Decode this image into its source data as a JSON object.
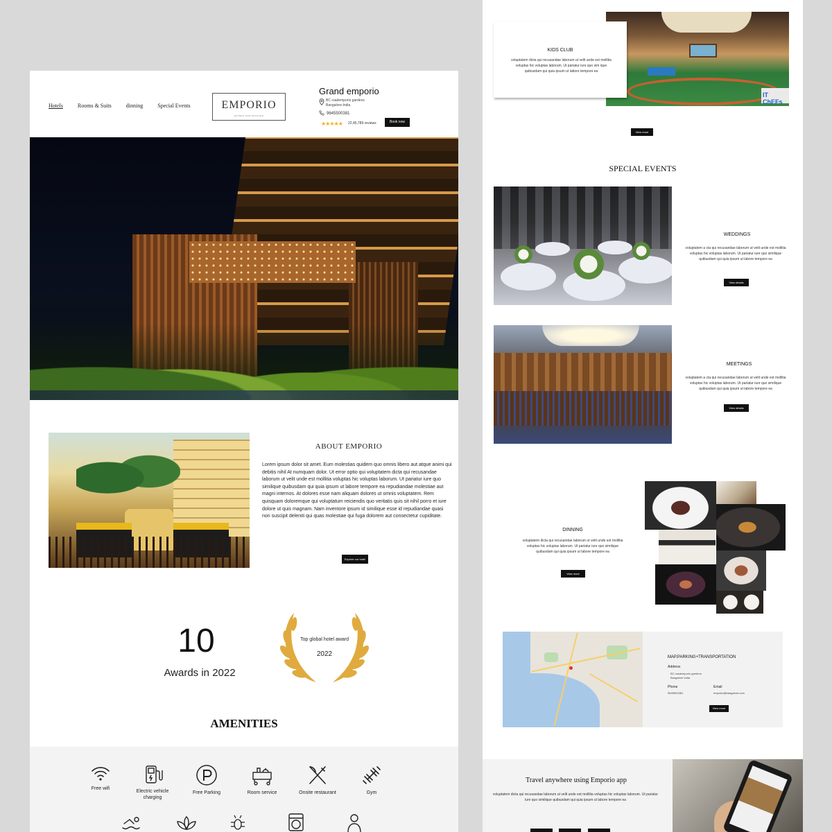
{
  "header": {
    "nav": [
      "Hotels",
      "Rooms & Suits",
      "dinning",
      "Special Events"
    ],
    "logo_text": "EMPORIO",
    "logo_sub": "HOTELS AND PALACES",
    "hotel_name": "Grand emporio",
    "address_line1": "BC roademporio gardens",
    "address_line2": "Bangalore-India",
    "phone": "9645500381",
    "stars": "★★★★★",
    "rating_value": "22,45,789",
    "rating_suffix": "reviews",
    "book_now": "Book now"
  },
  "about": {
    "title": "ABOUT EMPORIO",
    "text": "Lorem ipsum dolor sit amet. Eum molestias quidem quo omnis libero aut atque animi qui debitis nihil At numquam dolor. Ut error optio qui voluptatem dicta qui recusandae laborum ut velit unde est mollitia voluptas hic voluptas laborum. Ut pariatur iure quo similique quibusdam qui quia ipsum ut labore tempore ea repudiandae molestiae aut magni internos. At dolores esse nam aliquam dolores ut omnis voluptatem. Rem quisquam doloremque qui voluptatum reiciendis quo veritatis quis sit nihil porro et iure dolore ut quis magnam. Nam inventore ipsum id similique esse id repudiandae quasi non suscipit deleniti qui quas molestiae qui fuga dolorem aut consectetur cupiditate.",
    "button": "Explore our hotel"
  },
  "awards": {
    "count": "10",
    "label": "Awards in 2022",
    "badge_title": "Top global hotel award",
    "badge_year": "2022"
  },
  "amenities": {
    "title": "AMENITIES",
    "items": [
      {
        "label": "Free wifi",
        "icon": "wifi-icon"
      },
      {
        "label": "Electric vehicle charging",
        "icon": "ev-charging-icon"
      },
      {
        "label": "Free Parking",
        "icon": "parking-icon"
      },
      {
        "label": "Room service",
        "icon": "room-service-icon"
      },
      {
        "label": "Onsite restaurant",
        "icon": "restaurant-icon"
      },
      {
        "label": "Gym",
        "icon": "gym-icon"
      }
    ],
    "row2_icons": [
      "swimming-icon",
      "spa-icon",
      "bug-icon",
      "laundry-icon",
      "staff-icon"
    ]
  },
  "kids_club": {
    "title": "KIDS CLUB",
    "text": "voluptatem dicta qui recusandae laborum ut velit unde est mollitia voluptas hic voluptas laborum. Ut pariatur iure quo sim ique quibusdam qui quia ipsum ut labore tempore ea",
    "sign": "IT ChEFs",
    "button": "View more"
  },
  "special_events": {
    "title": "SPECIAL EVENTS",
    "weddings": {
      "title": "WEDDINGS",
      "text": "voluptatem a cta qui recusandae laborum ut velit unde est mollitia voluptas hic voluptas laborum. Ut pariatur iure quo similique quibusdam qui quia ipsum ut labore tempore ea",
      "button": "View details"
    },
    "meetings": {
      "title": "MEETINGS",
      "text": "voluptatem a cta qui recusandae laborum ut velit unde est mollitia voluptas hic voluptas laborum. Ut pariatur iure quo similique quibusdam qui quia ipsum ut labore tempore ea",
      "button": "View details"
    }
  },
  "dinning": {
    "title": "DINNING",
    "text": "voluptatem dicta qui recusandae laborum ut velit unde est mollitia voluptas hic voluptas laborum. Ut pariatur iure quo similique quibusdam qui quia ipsum ut labore tempore ea",
    "button": "View more"
  },
  "map": {
    "title": "MAP,PARKING+TRANSPORTATION",
    "address_label": "Address",
    "address_line1": "BC roademporio gardens",
    "address_line2": "Bangalore India",
    "phone_label": "Phone",
    "phone": "9645500381",
    "email_label": "Email",
    "email": "emporio@bangalore.com",
    "button": "View more"
  },
  "app": {
    "title": "Travel anywhere using Emporio app",
    "text": "voluptatem dicta qui recusandae laborum ut velit unde est mollitia voluptas hic voluptas laborum. Ut pariatur iure quo similique quibusdam qui quia ipsum ut labore tempore ea",
    "stores": [
      "app-store-badge",
      "google-play-badge",
      "app-gallery-badge"
    ]
  },
  "colors": {
    "accent_dark": "#111111",
    "star": "#f2b01e",
    "laurel": "#e0aa3e",
    "band_bg": "#f3f3f3",
    "canvas_bg": "#d9d9d9"
  }
}
